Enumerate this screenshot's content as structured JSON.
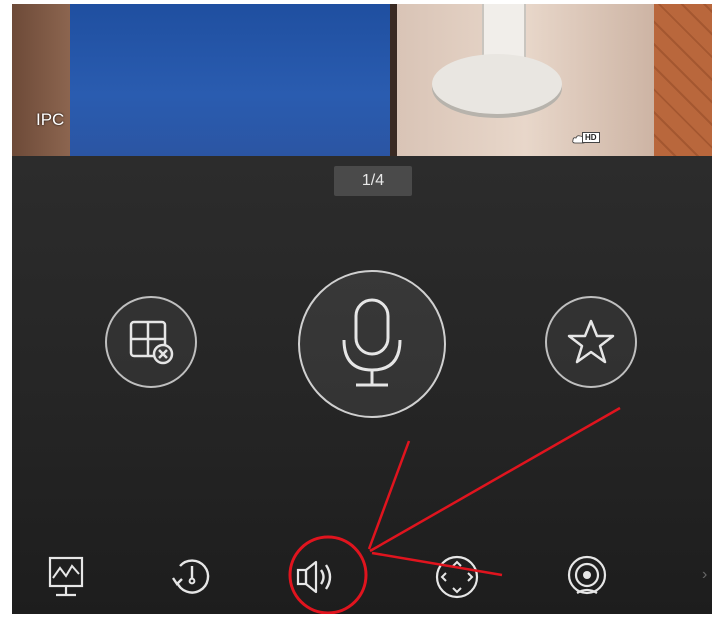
{
  "camera": {
    "label": "IPC",
    "badge": "HD"
  },
  "pager": {
    "text": "1/4"
  },
  "main_actions": [
    {
      "name": "close-split-screen",
      "icon": "grid-close-icon"
    },
    {
      "name": "talk",
      "icon": "microphone-icon"
    },
    {
      "name": "favorite",
      "icon": "star-icon"
    }
  ],
  "toolbar": [
    {
      "name": "report",
      "icon": "chart-monitor-icon"
    },
    {
      "name": "playback",
      "icon": "history-clock-icon"
    },
    {
      "name": "audio",
      "icon": "speaker-icon"
    },
    {
      "name": "ptz",
      "icon": "ptz-direction-icon"
    },
    {
      "name": "fisheye",
      "icon": "fisheye-camera-icon"
    }
  ],
  "more_arrow": "›",
  "colors": {
    "background": "#252525",
    "button_border": "#bfbfbf",
    "icon": "#e6e6e6",
    "annotation": "#e0141e"
  }
}
